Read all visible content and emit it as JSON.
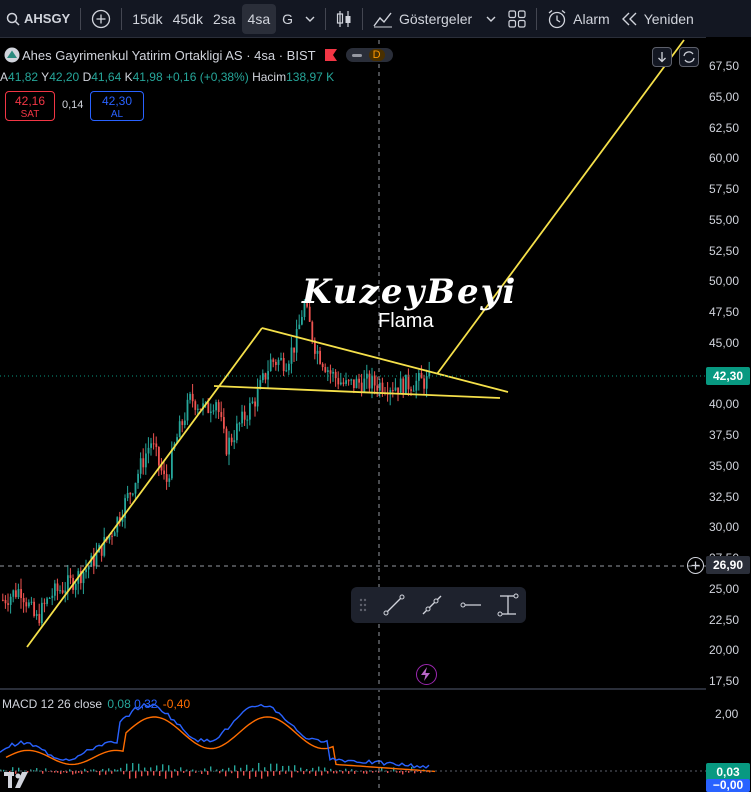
{
  "toolbar": {
    "symbol": "AHSGY",
    "intervals": [
      "15dk",
      "45dk",
      "2sa",
      "4sa",
      "G"
    ],
    "active_interval": "4sa",
    "indicators_label": "Göstergeler",
    "alarm_label": "Alarm",
    "replay_label": "Yeniden"
  },
  "legend": {
    "title": "Ahes Gayrimenkul Yatirim Ortakligi AS · 4sa · BIST",
    "badge": "D",
    "ohlc": {
      "o_label": "A",
      "o": "41,82",
      "h_label": "Y",
      "h": "42,20",
      "l_label": "D",
      "l": "41,64",
      "c_label": "K",
      "c": "41,98",
      "change": "+0,16 (+0,38%)",
      "volume_label": "Hacim",
      "volume": "138,97 K"
    },
    "sell_price": "42,16",
    "sell_label": "SAT",
    "spread": "0,14",
    "buy_price": "42,30",
    "buy_label": "AL"
  },
  "price_axis": {
    "ticks": [
      "67,50",
      "65,00",
      "62,50",
      "60,00",
      "57,50",
      "55,00",
      "52,50",
      "50,00",
      "47,50",
      "45,00",
      "42,50",
      "40,00",
      "37,50",
      "35,00",
      "32,50",
      "30,00",
      "27,50",
      "25,00",
      "22,50",
      "20,00",
      "17,50"
    ],
    "current_price": "42,30",
    "crosshair_price": "26,90"
  },
  "annotations": {
    "watermark": "KuzeyBeyi",
    "pattern_label": "Flama"
  },
  "macd": {
    "label": "MACD 12 26 close",
    "macd_value": "0,08",
    "signal_value": "0,32",
    "hist_value": "-0,40",
    "axis_ticks": [
      "2,00"
    ],
    "current_badge": "0,03",
    "zero_badge": "−0,00"
  },
  "colors": {
    "up": "#26a69a",
    "down": "#ef5350",
    "trendline": "#f5e04a",
    "macd_line": "#2962ff",
    "signal_line": "#ff6d00",
    "toolbar_bg": "#131722"
  }
}
